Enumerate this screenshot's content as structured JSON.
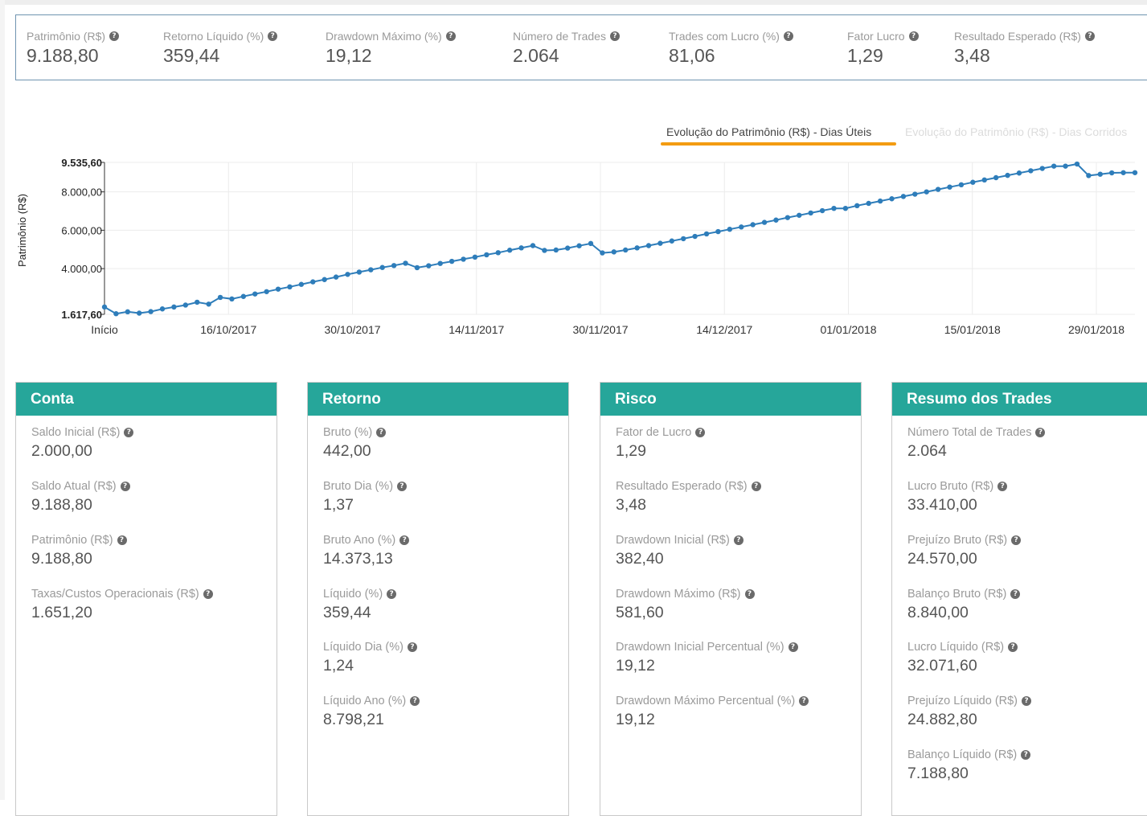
{
  "summary": [
    {
      "label": "Patrimônio (R$)",
      "value": "9.188,80"
    },
    {
      "label": "Retorno Líquido (%)",
      "value": "359,44"
    },
    {
      "label": "Drawdown Máximo (%)",
      "value": "19,12"
    },
    {
      "label": "Número de Trades",
      "value": "2.064"
    },
    {
      "label": "Trades com Lucro (%)",
      "value": "81,06"
    },
    {
      "label": "Fator Lucro",
      "value": "1,29"
    },
    {
      "label": "Resultado Esperado (R$)",
      "value": "3,48"
    }
  ],
  "help_glyph": "?",
  "tabs": [
    {
      "label": "Evolução do Patrimônio (R$) - Dias Úteis",
      "active": true
    },
    {
      "label": "Evolução do Patrimônio (R$) - Dias Corridos",
      "active": false
    }
  ],
  "colors": {
    "accent_teal": "#26a69a",
    "tab_underline": "#f39c12",
    "line": "#2e7dba",
    "summary_border": "#6f94b0"
  },
  "chart_data": {
    "type": "line",
    "ylabel": "Patrimônio (R$)",
    "xlabel": "",
    "ylim": [
      1617.6,
      9535.6
    ],
    "y_ticks": [
      "1.617,60",
      "4.000,00",
      "6.000,00",
      "8.000,00",
      "9.535,60"
    ],
    "y_tick_values": [
      1617.6,
      4000,
      6000,
      8000,
      9535.6
    ],
    "x_ticks": [
      "Início",
      "16/10/2017",
      "30/10/2017",
      "14/11/2017",
      "30/11/2017",
      "14/12/2017",
      "01/01/2018",
      "15/01/2018",
      "29/01/2018"
    ],
    "grid": true,
    "series": [
      {
        "values": [
          2000,
          1650,
          1750,
          1680,
          1760,
          1900,
          2000,
          2100,
          2250,
          2150,
          2500,
          2420,
          2550,
          2680,
          2800,
          2930,
          3050,
          3180,
          3310,
          3430,
          3560,
          3700,
          3820,
          3940,
          4060,
          4160,
          4280,
          4050,
          4150,
          4270,
          4380,
          4490,
          4600,
          4720,
          4830,
          4960,
          5080,
          5200,
          4950,
          4970,
          5070,
          5190,
          5310,
          4820,
          4870,
          4970,
          5080,
          5200,
          5320,
          5440,
          5560,
          5680,
          5810,
          5930,
          6050,
          6170,
          6290,
          6410,
          6530,
          6660,
          6780,
          6900,
          7020,
          7140,
          7140,
          7280,
          7400,
          7520,
          7640,
          7760,
          7880,
          8000,
          8130,
          8250,
          8370,
          8500,
          8620,
          8740,
          8860,
          8980,
          9100,
          9220,
          9340,
          9340,
          9450,
          8850,
          8920,
          8990,
          9000,
          9000
        ]
      }
    ]
  },
  "panels": [
    {
      "title": "Conta",
      "items": [
        {
          "label": "Saldo Inicial (R$)",
          "value": "2.000,00"
        },
        {
          "label": "Saldo Atual (R$)",
          "value": "9.188,80"
        },
        {
          "label": "Patrimônio (R$)",
          "value": "9.188,80"
        },
        {
          "label": "Taxas/Custos Operacionais (R$)",
          "value": "1.651,20"
        }
      ]
    },
    {
      "title": "Retorno",
      "items": [
        {
          "label": "Bruto (%)",
          "value": "442,00"
        },
        {
          "label": "Bruto Dia (%)",
          "value": "1,37"
        },
        {
          "label": "Bruto Ano (%)",
          "value": "14.373,13"
        },
        {
          "label": "Líquido (%)",
          "value": "359,44"
        },
        {
          "label": "Líquido Dia (%)",
          "value": "1,24"
        },
        {
          "label": "Líquido Ano (%)",
          "value": "8.798,21"
        }
      ]
    },
    {
      "title": "Risco",
      "items": [
        {
          "label": "Fator de Lucro",
          "value": "1,29"
        },
        {
          "label": "Resultado Esperado (R$)",
          "value": "3,48"
        },
        {
          "label": "Drawdown Inicial (R$)",
          "value": "382,40"
        },
        {
          "label": "Drawdown Máximo (R$)",
          "value": "581,60"
        },
        {
          "label": "Drawdown Inicial Percentual (%)",
          "value": "19,12"
        },
        {
          "label": "Drawdown Máximo Percentual (%)",
          "value": "19,12"
        }
      ]
    },
    {
      "title": "Resumo dos Trades",
      "items": [
        {
          "label": "Número Total de Trades",
          "value": "2.064"
        },
        {
          "label": "Lucro Bruto (R$)",
          "value": "33.410,00"
        },
        {
          "label": "Prejuízo Bruto (R$)",
          "value": "24.570,00"
        },
        {
          "label": "Balanço Bruto (R$)",
          "value": "8.840,00"
        },
        {
          "label": "Lucro Líquido (R$)",
          "value": "32.071,60"
        },
        {
          "label": "Prejuízo Líquido (R$)",
          "value": "24.882,80"
        },
        {
          "label": "Balanço Líquido (R$)",
          "value": "7.188,80"
        }
      ]
    }
  ]
}
